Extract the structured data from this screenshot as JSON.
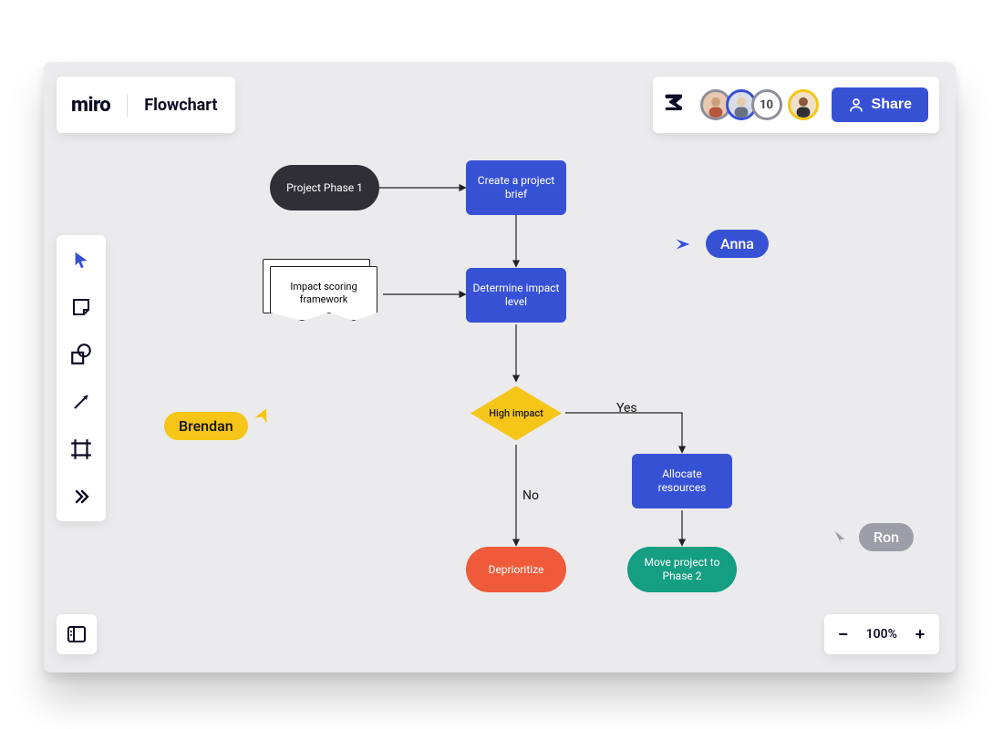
{
  "app": {
    "logo": "miro",
    "title": "Flowchart"
  },
  "header": {
    "overflow_count": "10",
    "share_label": "Share"
  },
  "avatar_colors": {
    "a1": "#8f8f9a",
    "a2": "#3751d5",
    "a3": "#8f8f9a",
    "a4": "#f5c518"
  },
  "zoom": {
    "level": "100%"
  },
  "flow": {
    "start": "Project Phase 1",
    "brief": "Create a project brief",
    "doc": "Impact scoring framework",
    "determine": "Determine impact level",
    "decision": "High impact",
    "yes": "Yes",
    "no": "No",
    "allocate": "Allocate resources",
    "deprioritize": "Deprioritize",
    "phase2": "Move project to Phase 2"
  },
  "cursors": {
    "brendan": "Brendan",
    "anna": "Anna",
    "ron": "Ron"
  },
  "colors": {
    "accent": "#3751d5",
    "warn": "#f5c518",
    "danger": "#ee5a3a",
    "ok": "#149e82"
  }
}
